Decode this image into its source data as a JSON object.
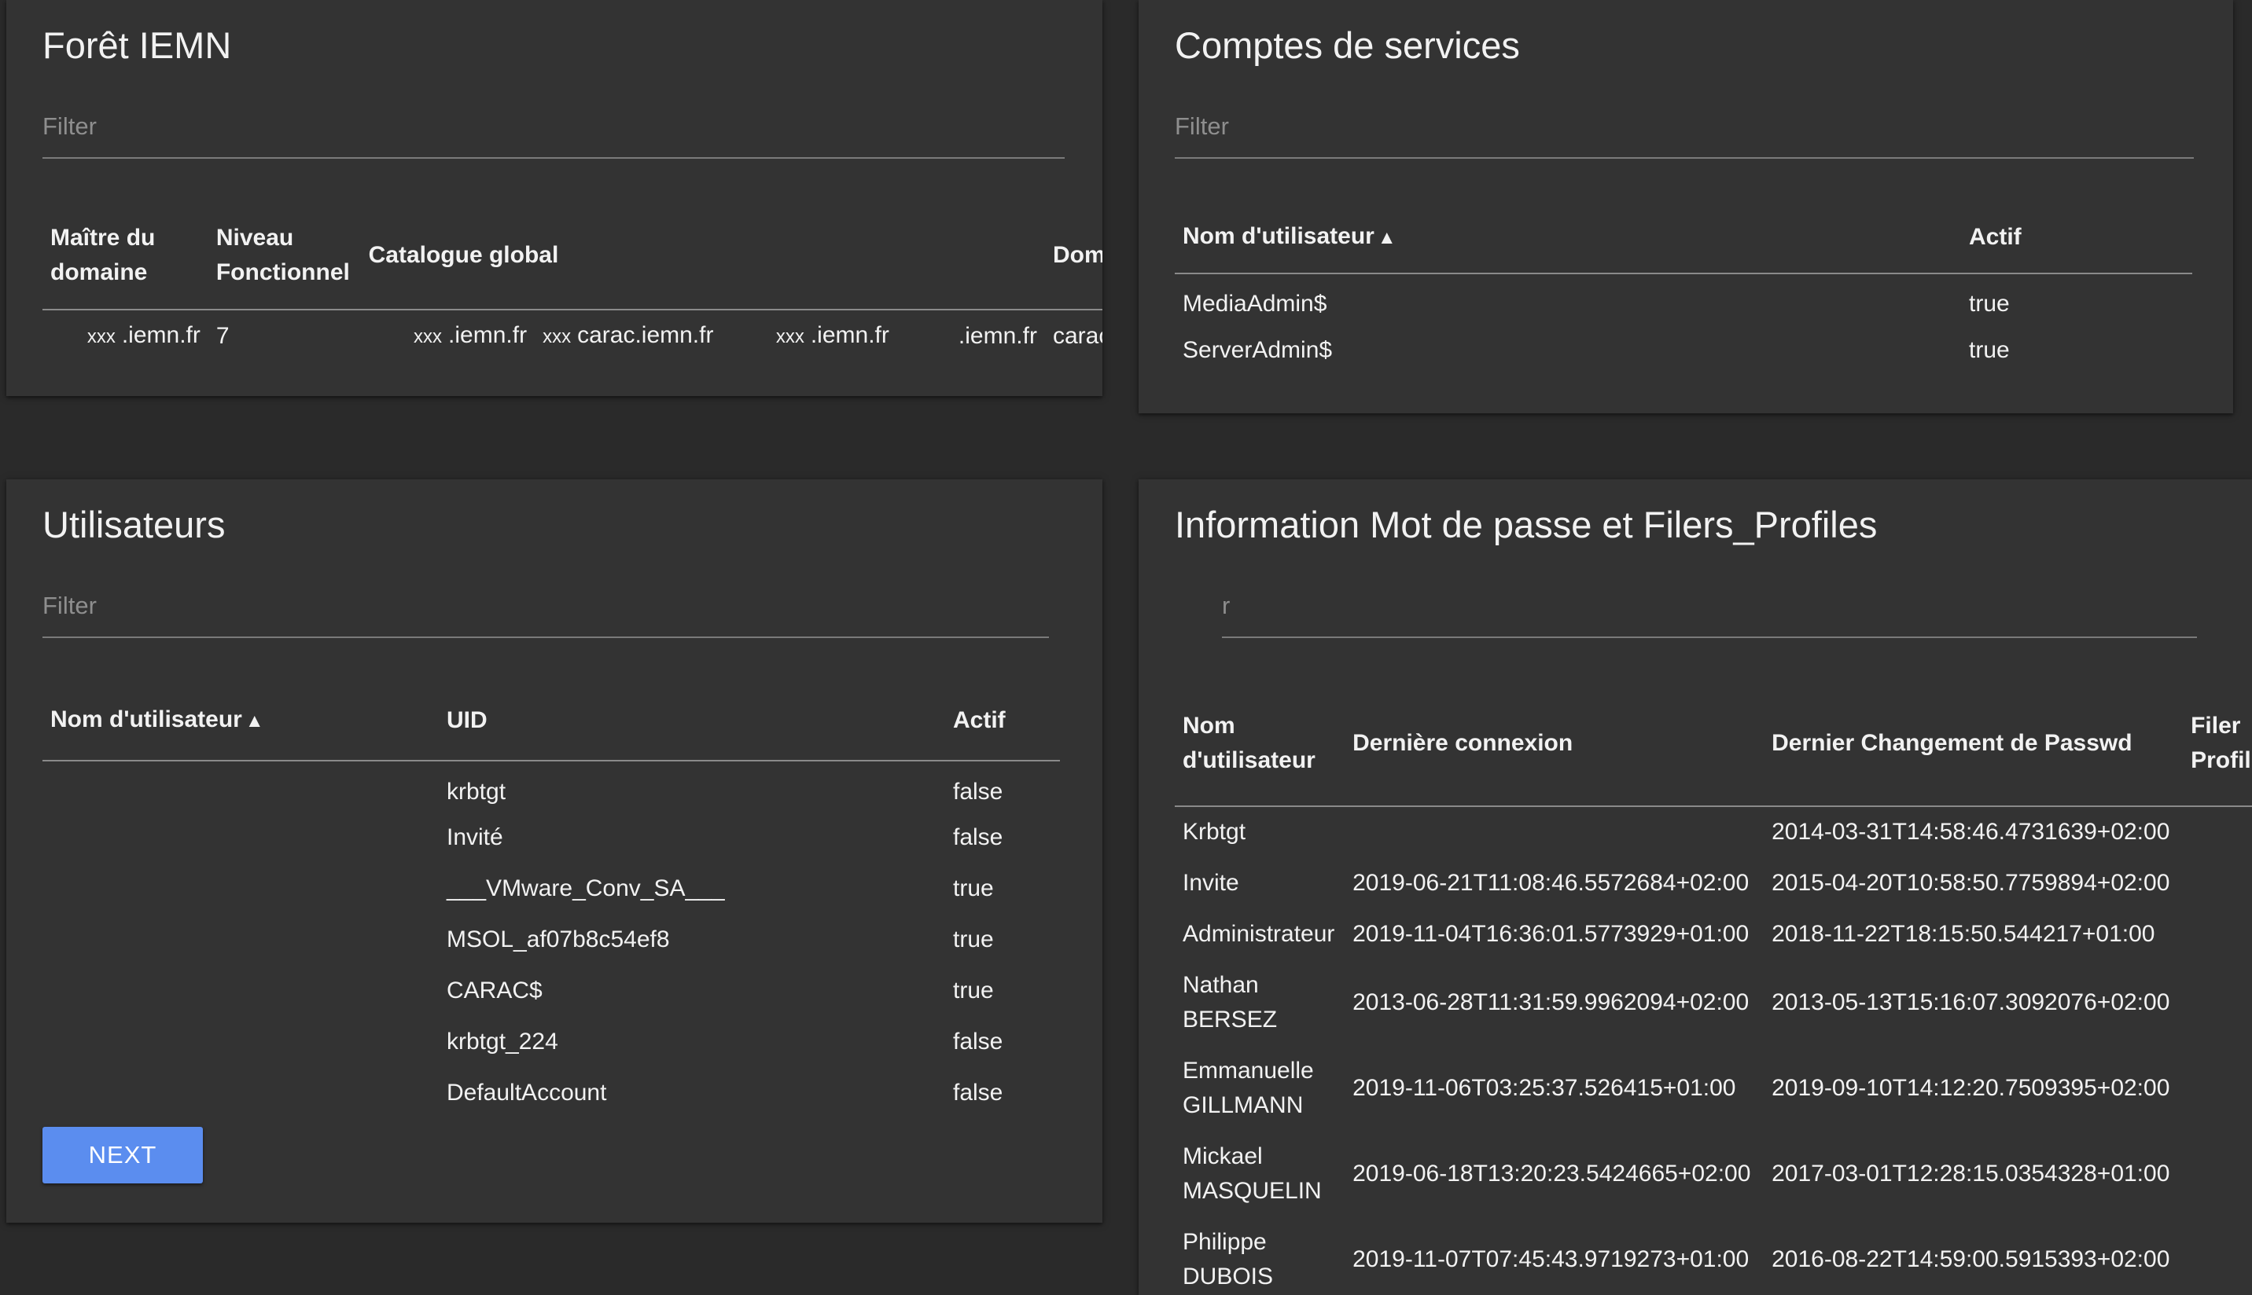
{
  "foret": {
    "title": "Forêt IEMN",
    "filter_placeholder": "Filter",
    "columns": [
      "Maître du domaine",
      "Niveau Fonctionnel",
      "Catalogue global",
      "Domai"
    ],
    "row": {
      "maitre_prefix": "xxx",
      "maitre": ".iemn.fr",
      "niveau": "7",
      "catalogue_1_prefix": "xxx",
      "catalogue_1": ".iemn.fr",
      "catalogue_2_prefix": "xxx",
      "catalogue_2": "carac.iemn.fr",
      "catalogue_3_prefix": "xxx",
      "catalogue_3": ".iemn.fr",
      "catalogue_4": ".iemn.fr",
      "domaine": "carac.ie"
    }
  },
  "comptes": {
    "title": "Comptes de services",
    "filter_placeholder": "Filter",
    "columns": [
      "Nom d'utilisateur",
      "Actif"
    ],
    "sort_arrow": "▲",
    "rows": [
      {
        "name": "MediaAdmin$",
        "actif": "true"
      },
      {
        "name": "ServerAdmin$",
        "actif": "true"
      }
    ]
  },
  "users": {
    "title": "Utilisateurs",
    "filter_placeholder": "Filter",
    "columns": [
      "Nom d'utilisateur",
      "UID",
      "Actif"
    ],
    "sort_arrow": "▲",
    "rows": [
      {
        "name": "",
        "uid": "krbtgt",
        "actif": "false"
      },
      {
        "name": "",
        "uid": "Invité",
        "actif": "false"
      },
      {
        "name": "",
        "uid": "___VMware_Conv_SA___",
        "actif": "true"
      },
      {
        "name": "",
        "uid": "MSOL_af07b8c54ef8",
        "actif": "true"
      },
      {
        "name": "",
        "uid": "CARAC$",
        "actif": "true"
      },
      {
        "name": "",
        "uid": "krbtgt_224",
        "actif": "false"
      },
      {
        "name": "",
        "uid": "DefaultAccount",
        "actif": "false"
      }
    ],
    "next_label": "NEXT"
  },
  "info": {
    "title": "Information Mot de passe et Filers_Profiles",
    "filter_placeholder": "r",
    "columns": [
      "Nom d'utilisateur",
      "Dernière connexion",
      "Dernier Changement de Passwd",
      "Filer Profil"
    ],
    "rows": [
      {
        "name": "Krbtgt",
        "last_login": "",
        "last_pwd": "2014-03-31T14:58:46.4731639+02:00"
      },
      {
        "name": "Invite",
        "last_login": "2019-06-21T11:08:46.5572684+02:00",
        "last_pwd": "2015-04-20T10:58:50.7759894+02:00"
      },
      {
        "name": "Administrateur",
        "last_login": "2019-11-04T16:36:01.5773929+01:00",
        "last_pwd": "2018-11-22T18:15:50.544217+01:00"
      },
      {
        "name": "Nathan BERSEZ",
        "last_login": "2013-06-28T11:31:59.9962094+02:00",
        "last_pwd": "2013-05-13T15:16:07.3092076+02:00"
      },
      {
        "name": "Emmanuelle GILLMANN",
        "last_login": "2019-11-06T03:25:37.526415+01:00",
        "last_pwd": "2019-09-10T14:12:20.7509395+02:00"
      },
      {
        "name": "Mickael MASQUELIN",
        "last_login": "2019-06-18T13:20:23.5424665+02:00",
        "last_pwd": "2017-03-01T12:28:15.0354328+01:00"
      },
      {
        "name": "Philippe DUBOIS",
        "last_login": "2019-11-07T07:45:43.9719273+01:00",
        "last_pwd": "2016-08-22T14:59:00.5915393+02:00"
      }
    ]
  }
}
